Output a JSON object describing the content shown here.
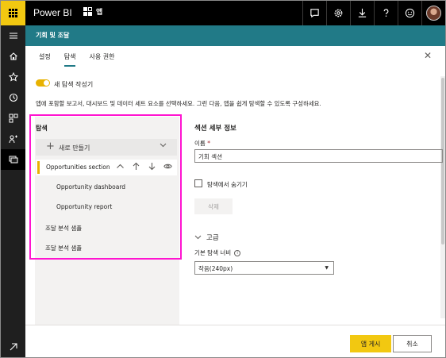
{
  "topbar": {
    "brand": "Power BI",
    "breadcrumb": "앱",
    "icons": [
      "notification-icon",
      "settings-icon",
      "download-icon",
      "help-icon",
      "feedback-smiley-icon"
    ]
  },
  "leftnav": {
    "items": [
      "hamburger-icon",
      "home-icon",
      "favorites-icon",
      "recent-icon",
      "apps-icon",
      "shared-icon",
      "workspaces-icon"
    ],
    "bottom": "expand-icon"
  },
  "header": {
    "title": "기회 및 조달"
  },
  "tabs": [
    {
      "label": "설정",
      "active": false
    },
    {
      "label": "탐색",
      "active": true
    },
    {
      "label": "사용 권한",
      "active": false
    }
  ],
  "toggle": {
    "label": "새 탐색 작성기",
    "on": true
  },
  "description": "앱에 포함할 보고서, 대시보드 및 데이터 세트 요소를 선택하세요. 그런 다음, 앱을 쉽게 탐색할 수 있도록 구성하세요.",
  "nav_panel": {
    "title": "탐색",
    "create_label": "새로 만들기",
    "section": {
      "label": "Opportunities section"
    },
    "children": [
      "Opportunity dashboard",
      "Opportunity report"
    ],
    "items": [
      "조달 분석 샘플",
      "조달 분석 샘플"
    ]
  },
  "details": {
    "title": "섹션 세부 정보",
    "name_label": "이름",
    "required_mark": "*",
    "name_value": "기회 섹션",
    "hide_label": "탐색에서 숨기기",
    "delete_label": "삭제",
    "advanced_label": "고급",
    "width_label": "기본 탐색 너비",
    "width_value": "작음(240px)"
  },
  "footer": {
    "publish_label": "앱 게시",
    "cancel_label": "취소"
  },
  "colors": {
    "accent": "#217a87",
    "brand_yellow": "#f2c811",
    "highlight": "#ff14d0"
  }
}
